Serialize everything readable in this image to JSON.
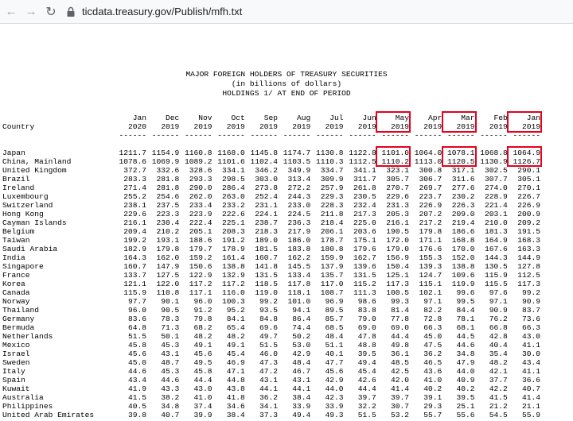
{
  "browser": {
    "url": "ticdata.treasury.gov/Publish/mfh.txt"
  },
  "report": {
    "title": "MAJOR FOREIGN HOLDERS OF TREASURY SECURITIES",
    "subtitle": "(in billions of dollars)",
    "subtitle2": "HOLDINGS 1/ AT END OF PERIOD",
    "country_header": "Country",
    "months": [
      "Jan",
      "Dec",
      "Nov",
      "Oct",
      "Sep",
      "Aug",
      "Jul",
      "Jun",
      "May",
      "Apr",
      "Mar",
      "Feb",
      "Jan"
    ],
    "years": [
      "2020",
      "2019",
      "2019",
      "2019",
      "2019",
      "2019",
      "2019",
      "2019",
      "2019",
      "2019",
      "2019",
      "2019",
      "2019"
    ],
    "dashes": "------",
    "highlighted_columns": [
      8,
      10,
      12
    ],
    "rows": [
      {
        "country": "Japan",
        "values": [
          "1211.7",
          "1154.9",
          "1160.8",
          "1168.0",
          "1145.8",
          "1174.7",
          "1130.8",
          "1122.8",
          "1101.0",
          "1064.0",
          "1078.1",
          "1068.8",
          "1064.9"
        ]
      },
      {
        "country": "China, Mainland",
        "values": [
          "1078.6",
          "1069.9",
          "1089.2",
          "1101.6",
          "1102.4",
          "1103.5",
          "1110.3",
          "1112.5",
          "1110.2",
          "1113.0",
          "1120.5",
          "1130.9",
          "1126.7"
        ]
      },
      {
        "country": "United Kingdom",
        "values": [
          "372.7",
          "332.6",
          "328.6",
          "334.1",
          "346.2",
          "349.9",
          "334.7",
          "341.1",
          "323.1",
          "300.8",
          "317.1",
          "302.5",
          "290.1"
        ]
      },
      {
        "country": "Brazil",
        "values": [
          "283.3",
          "281.8",
          "293.3",
          "298.5",
          "303.0",
          "313.4",
          "309.9",
          "311.7",
          "305.7",
          "306.7",
          "311.6",
          "307.7",
          "305.1"
        ]
      },
      {
        "country": "Ireland",
        "values": [
          "271.4",
          "281.8",
          "290.0",
          "286.4",
          "273.8",
          "272.2",
          "257.9",
          "261.8",
          "270.7",
          "269.7",
          "277.6",
          "274.0",
          "270.1"
        ]
      },
      {
        "country": "Luxembourg",
        "values": [
          "255.2",
          "254.6",
          "262.0",
          "263.0",
          "252.4",
          "244.3",
          "229.3",
          "230.5",
          "229.6",
          "223.7",
          "230.2",
          "228.9",
          "226.7"
        ]
      },
      {
        "country": "Switzerland",
        "values": [
          "238.1",
          "237.5",
          "233.4",
          "233.2",
          "231.1",
          "233.0",
          "228.3",
          "232.4",
          "231.3",
          "226.9",
          "226.3",
          "221.4",
          "226.9"
        ]
      },
      {
        "country": "Hong Kong",
        "values": [
          "229.6",
          "223.3",
          "223.9",
          "222.6",
          "224.1",
          "224.5",
          "211.8",
          "217.3",
          "205.3",
          "207.2",
          "209.0",
          "203.1",
          "200.9"
        ]
      },
      {
        "country": "Cayman Islands",
        "values": [
          "216.1",
          "230.4",
          "222.4",
          "225.1",
          "238.7",
          "236.3",
          "218.4",
          "225.0",
          "216.1",
          "217.2",
          "219.4",
          "210.0",
          "209.2"
        ]
      },
      {
        "country": "Belgium",
        "values": [
          "209.4",
          "210.2",
          "205.1",
          "208.3",
          "218.3",
          "217.9",
          "206.1",
          "203.6",
          "190.5",
          "179.8",
          "186.6",
          "181.3",
          "191.5"
        ]
      },
      {
        "country": "Taiwan",
        "values": [
          "199.2",
          "193.1",
          "188.6",
          "191.2",
          "189.0",
          "186.0",
          "178.7",
          "175.1",
          "172.0",
          "171.1",
          "168.8",
          "164.9",
          "168.3"
        ]
      },
      {
        "country": "Saudi Arabia",
        "values": [
          "182.9",
          "179.8",
          "179.7",
          "178.9",
          "181.5",
          "183.8",
          "180.8",
          "179.6",
          "179.0",
          "176.6",
          "170.0",
          "167.6",
          "163.3"
        ]
      },
      {
        "country": "India",
        "values": [
          "164.3",
          "162.0",
          "159.2",
          "161.4",
          "160.7",
          "162.2",
          "159.9",
          "162.7",
          "156.9",
          "155.3",
          "152.0",
          "144.3",
          "144.9"
        ]
      },
      {
        "country": "Singapore",
        "values": [
          "160.7",
          "147.9",
          "150.6",
          "138.8",
          "141.8",
          "145.5",
          "137.9",
          "139.6",
          "150.4",
          "139.3",
          "138.8",
          "130.5",
          "127.8"
        ]
      },
      {
        "country": "France",
        "values": [
          "133.7",
          "127.5",
          "122.9",
          "132.9",
          "131.5",
          "133.4",
          "135.7",
          "131.5",
          "125.1",
          "124.7",
          "109.6",
          "115.9",
          "112.5"
        ]
      },
      {
        "country": "Korea",
        "values": [
          "121.1",
          "122.0",
          "117.2",
          "117.2",
          "118.5",
          "117.8",
          "117.0",
          "115.2",
          "117.3",
          "115.1",
          "119.9",
          "115.5",
          "117.3"
        ]
      },
      {
        "country": "Canada",
        "values": [
          "115.9",
          "110.8",
          "117.1",
          "116.0",
          "119.0",
          "118.1",
          "108.7",
          "111.3",
          "100.5",
          "102.1",
          "99.6",
          "97.6",
          "99.2"
        ]
      },
      {
        "country": "Norway",
        "values": [
          "97.7",
          "90.1",
          "96.0",
          "100.3",
          "99.2",
          "101.0",
          "96.9",
          "98.6",
          "99.3",
          "97.1",
          "99.5",
          "97.1",
          "90.9"
        ]
      },
      {
        "country": "Thailand",
        "values": [
          "96.0",
          "90.5",
          "91.2",
          "95.2",
          "93.5",
          "94.1",
          "89.5",
          "83.8",
          "81.4",
          "82.2",
          "84.4",
          "90.9",
          "83.7"
        ]
      },
      {
        "country": "Germany",
        "values": [
          "83.6",
          "78.3",
          "79.8",
          "84.1",
          "84.8",
          "86.4",
          "85.7",
          "79.0",
          "77.8",
          "72.8",
          "78.1",
          "76.2",
          "73.6"
        ]
      },
      {
        "country": "Bermuda",
        "values": [
          "64.8",
          "71.3",
          "68.2",
          "65.4",
          "69.6",
          "74.4",
          "68.5",
          "69.0",
          "69.0",
          "66.3",
          "68.1",
          "66.8",
          "66.3"
        ]
      },
      {
        "country": "Netherlands",
        "values": [
          "51.5",
          "50.1",
          "48.2",
          "48.2",
          "49.7",
          "50.2",
          "48.4",
          "47.8",
          "44.4",
          "45.0",
          "44.5",
          "42.8",
          "43.0"
        ]
      },
      {
        "country": "Mexico",
        "values": [
          "45.8",
          "45.3",
          "49.1",
          "49.1",
          "51.5",
          "53.0",
          "51.1",
          "48.8",
          "49.8",
          "47.5",
          "44.6",
          "40.4",
          "41.1"
        ]
      },
      {
        "country": "Israel",
        "values": [
          "45.6",
          "43.1",
          "45.6",
          "45.4",
          "46.0",
          "42.9",
          "40.1",
          "39.5",
          "36.1",
          "36.2",
          "34.8",
          "35.4",
          "30.0"
        ]
      },
      {
        "country": "Sweden",
        "values": [
          "45.0",
          "48.7",
          "49.5",
          "46.9",
          "47.3",
          "48.4",
          "47.7",
          "49.4",
          "48.5",
          "46.5",
          "47.9",
          "48.2",
          "43.4"
        ]
      },
      {
        "country": "Italy",
        "values": [
          "44.6",
          "45.3",
          "45.8",
          "47.1",
          "47.2",
          "46.7",
          "45.6",
          "45.4",
          "42.5",
          "43.6",
          "44.0",
          "42.1",
          "41.1"
        ]
      },
      {
        "country": "Spain",
        "values": [
          "43.4",
          "44.6",
          "44.4",
          "44.8",
          "43.1",
          "43.1",
          "42.9",
          "42.6",
          "42.0",
          "41.0",
          "40.9",
          "37.7",
          "36.6"
        ]
      },
      {
        "country": "Kuwait",
        "values": [
          "41.9",
          "43.3",
          "43.0",
          "43.8",
          "44.1",
          "44.1",
          "44.0",
          "44.4",
          "41.4",
          "40.2",
          "40.2",
          "42.2",
          "40.7"
        ]
      },
      {
        "country": "Australia",
        "values": [
          "41.5",
          "38.2",
          "41.0",
          "41.8",
          "36.2",
          "38.4",
          "42.3",
          "39.7",
          "39.7",
          "39.1",
          "39.5",
          "41.5",
          "41.4"
        ]
      },
      {
        "country": "Philippines",
        "values": [
          "40.5",
          "34.8",
          "37.4",
          "34.6",
          "34.1",
          "33.9",
          "33.9",
          "32.2",
          "30.7",
          "29.3",
          "25.1",
          "21.2",
          "21.1"
        ]
      },
      {
        "country": "United Arab Emirates",
        "values": [
          "39.8",
          "40.7",
          "39.9",
          "38.4",
          "37.3",
          "49.4",
          "49.3",
          "51.5",
          "53.2",
          "55.7",
          "55.6",
          "54.5",
          "55.9"
        ]
      }
    ]
  }
}
